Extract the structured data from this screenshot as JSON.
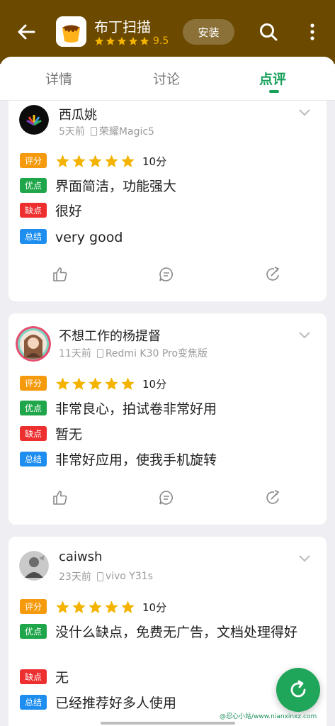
{
  "header": {
    "app_name": "布丁扫描",
    "rating_score": "9.5",
    "rating_stars": 5,
    "install_label": "安装",
    "back_icon": "arrow-left-icon",
    "search_icon": "search-icon",
    "more_icon": "more-vertical-icon",
    "colors": {
      "background": "#6b4a00",
      "star": "#f3b300"
    }
  },
  "tabs": [
    {
      "label": "详情",
      "active": false
    },
    {
      "label": "讨论",
      "active": false
    },
    {
      "label": "点评",
      "active": true
    }
  ],
  "tab_accent": "#17a05a",
  "tag_labels": {
    "score": "评分",
    "pros": "优点",
    "cons": "缺点",
    "summary": "总结"
  },
  "reviews": [
    {
      "user": "西瓜姚",
      "time": "5天前",
      "device": "荣耀Magic5",
      "stars": 5,
      "score": "10分",
      "pros": "界面简洁，功能强大",
      "cons": "很好",
      "summary": "very good"
    },
    {
      "user": "不想工作的杨提督",
      "time": "11天前",
      "device": "Redmi K30 Pro变焦版",
      "stars": 5,
      "score": "10分",
      "pros": "非常良心，拍试卷非常好用",
      "cons": "暂无",
      "summary": "非常好应用，使我手机旋转"
    },
    {
      "user": "caiwsh",
      "time": "23天前",
      "device": "vivo Y31s",
      "stars": 5,
      "score": "10分",
      "pros": "没什么缺点，免费无广告，文档处理得好",
      "cons": "无",
      "summary": "已经推荐好多人使用"
    }
  ],
  "action_icons": [
    "thumb-up-icon",
    "comment-icon",
    "share-icon"
  ],
  "fab_icon": "refresh-icon",
  "watermark": "@忍心小站/www.nianxinxz.com"
}
